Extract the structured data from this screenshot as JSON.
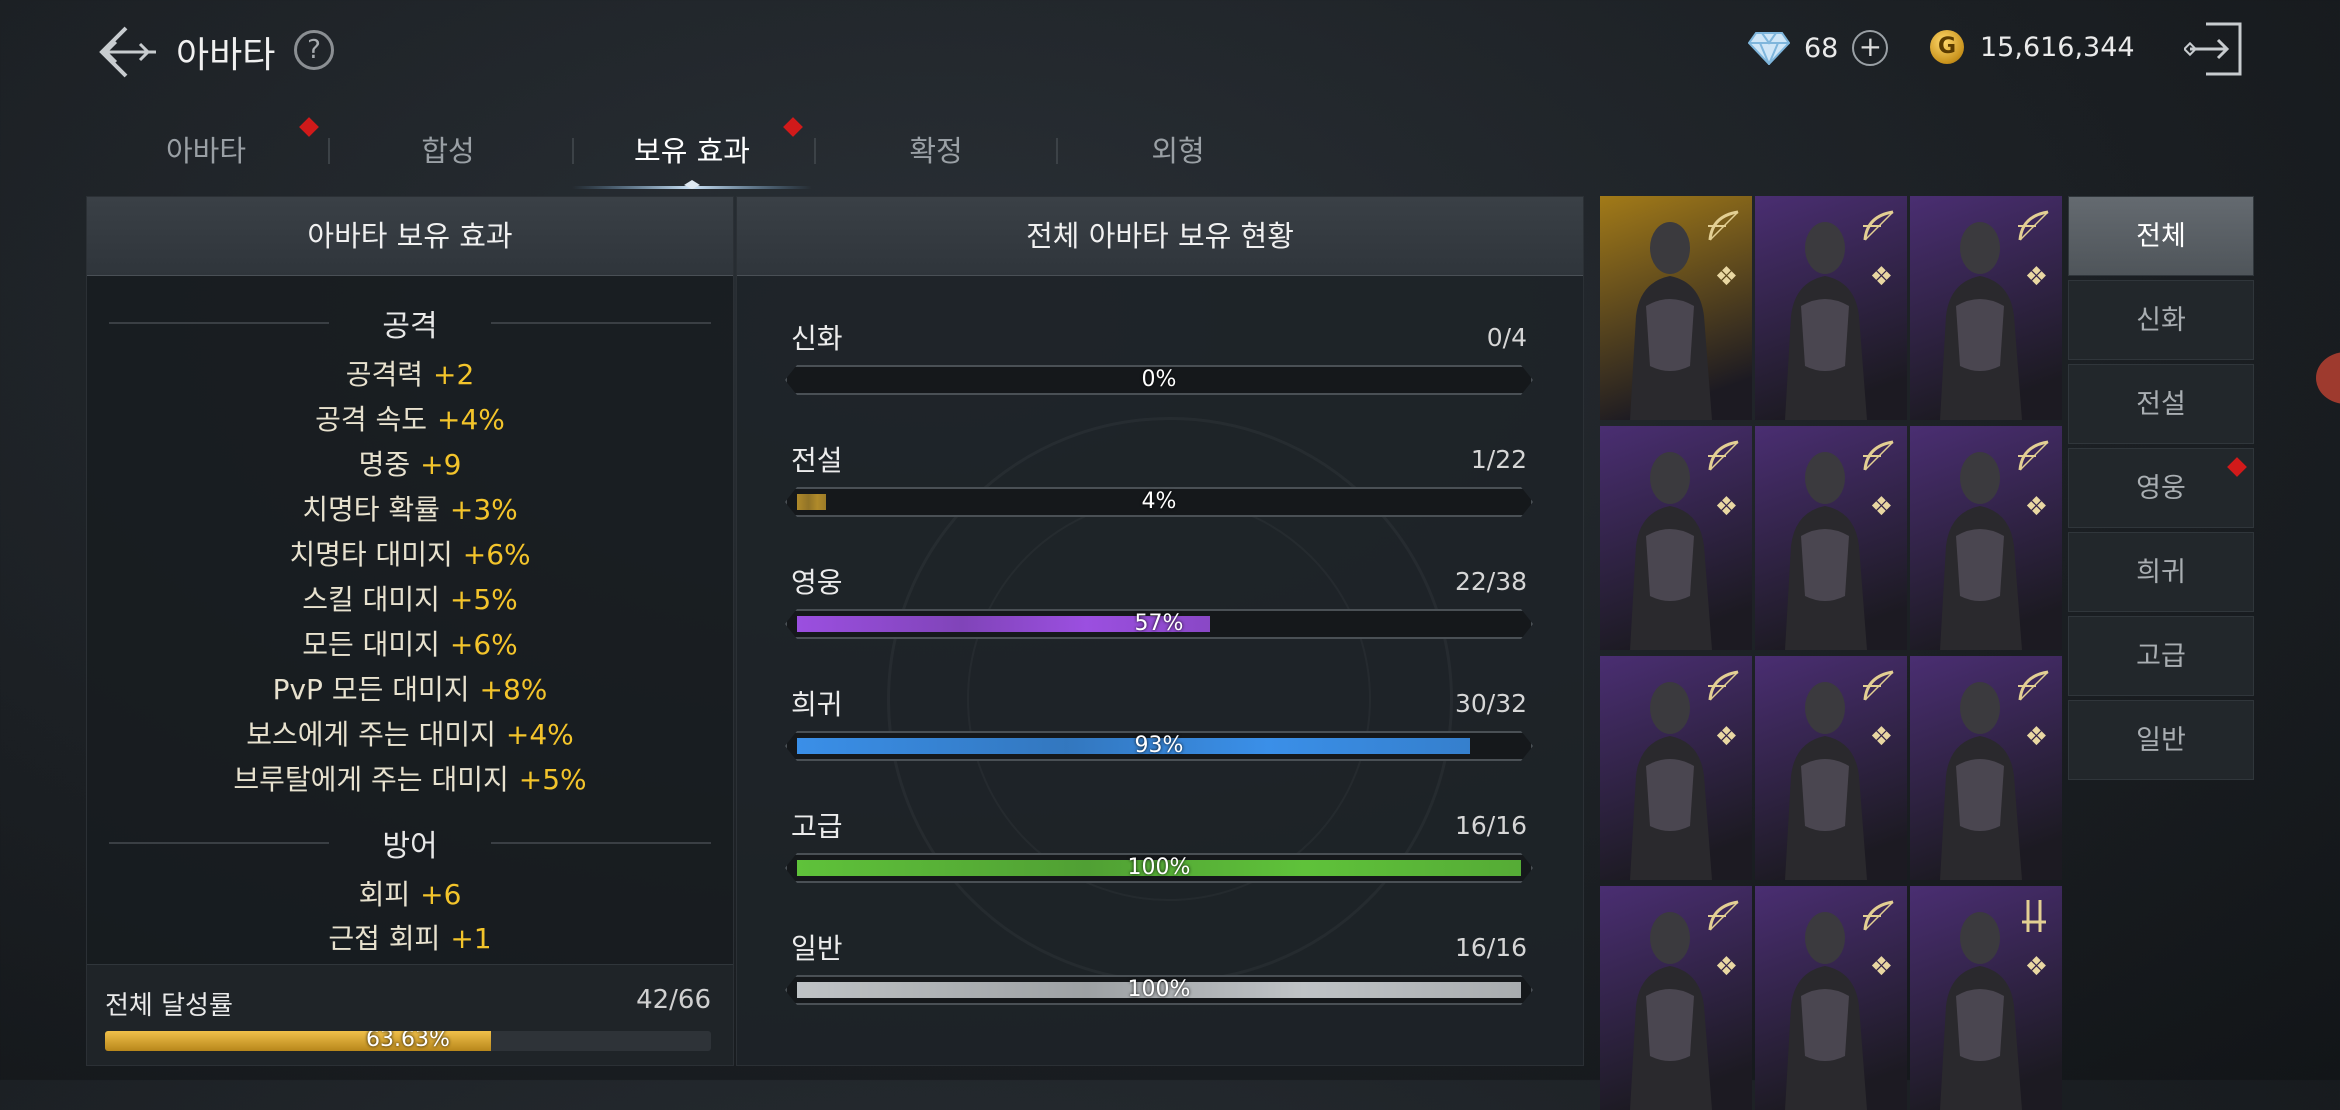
{
  "header": {
    "title": "아바타",
    "help_label": "?",
    "diamonds": "68",
    "gold": "15,616,344",
    "gold_symbol": "G"
  },
  "tabs": [
    {
      "label": "아바타",
      "alert": true
    },
    {
      "label": "합성",
      "alert": false
    },
    {
      "label": "보유 효과",
      "alert": true,
      "active": true
    },
    {
      "label": "확정",
      "alert": false
    },
    {
      "label": "외형",
      "alert": false
    }
  ],
  "effects_panel": {
    "title": "아바타 보유 효과",
    "attack_title": "공격",
    "attack": [
      {
        "name": "공격력",
        "value": "+2"
      },
      {
        "name": "공격 속도",
        "value": "+4%"
      },
      {
        "name": "명중",
        "value": "+9"
      },
      {
        "name": "치명타 확률",
        "value": "+3%"
      },
      {
        "name": "치명타 대미지",
        "value": "+6%"
      },
      {
        "name": "스킬 대미지",
        "value": "+5%"
      },
      {
        "name": "모든 대미지",
        "value": "+6%"
      },
      {
        "name": "PvP 모든 대미지",
        "value": "+8%"
      },
      {
        "name": "보스에게 주는 대미지",
        "value": "+4%"
      },
      {
        "name": "브루탈에게 주는 대미지",
        "value": "+5%"
      }
    ],
    "defense_title": "방어",
    "defense": [
      {
        "name": "회피",
        "value": "+6"
      },
      {
        "name": "근접 회피",
        "value": "+1"
      }
    ],
    "total_label": "전체 달성률",
    "total_count": "42/66",
    "total_pct_label": "63.63%",
    "total_fraction": 0.6363
  },
  "status_panel": {
    "title": "전체 아바타 보유 현황",
    "rarities": [
      {
        "name": "신화",
        "count": "0/4",
        "pct": "0%",
        "fraction": 0.0,
        "color": "#b08a2a"
      },
      {
        "name": "전설",
        "count": "1/22",
        "pct": "4%",
        "fraction": 0.04,
        "color": "#b08a2a"
      },
      {
        "name": "영웅",
        "count": "22/38",
        "pct": "57%",
        "fraction": 0.57,
        "color": "#9b4fe0"
      },
      {
        "name": "희귀",
        "count": "30/32",
        "pct": "93%",
        "fraction": 0.93,
        "color": "#3a8fe8"
      },
      {
        "name": "고급",
        "count": "16/16",
        "pct": "100%",
        "fraction": 1.0,
        "color": "#5fc23a"
      },
      {
        "name": "일반",
        "count": "16/16",
        "pct": "100%",
        "fraction": 1.0,
        "color": "#bfc3c6"
      }
    ]
  },
  "avatar_grid": [
    {
      "bg": "#a27a18",
      "badge": "bow-icon"
    },
    {
      "bg": "#4a2e72",
      "badge": "bow-icon"
    },
    {
      "bg": "#4a2e72",
      "badge": "bow-icon"
    },
    {
      "bg": "#4a2e72",
      "badge": "bow-icon"
    },
    {
      "bg": "#4a2e72",
      "badge": "bow-icon"
    },
    {
      "bg": "#4a2e72",
      "badge": "bow-icon"
    },
    {
      "bg": "#4a2e72",
      "badge": "bow-icon"
    },
    {
      "bg": "#4a2e72",
      "badge": "bow-icon"
    },
    {
      "bg": "#4a2e72",
      "badge": "bow-icon"
    },
    {
      "bg": "#4a2e72",
      "badge": "bow-icon"
    },
    {
      "bg": "#4a2e72",
      "badge": "bow-icon"
    },
    {
      "bg": "#4a2e72",
      "badge": "dagger-icon"
    }
  ],
  "filters": [
    {
      "label": "전체",
      "active": true
    },
    {
      "label": "신화"
    },
    {
      "label": "전설"
    },
    {
      "label": "영웅",
      "alert": true
    },
    {
      "label": "희귀"
    },
    {
      "label": "고급"
    },
    {
      "label": "일반"
    }
  ]
}
